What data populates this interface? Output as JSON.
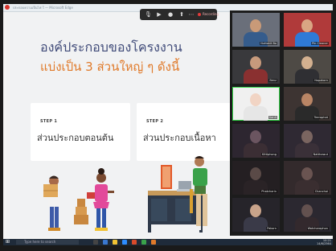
{
  "app": {
    "window_title": "ประกอบความเป็นไฟ ใ — Microsoft Edge",
    "record_label": "Recording"
  },
  "slide": {
    "heading_line1": "องค์ประกอบของโครงงาน",
    "heading_line2": "แบ่งเป็น 3 ส่วนใหญ่ ๆ ดังนี้",
    "cards": [
      {
        "step": "STEP 1",
        "label": "ส่วนประกอบตอนต้น"
      },
      {
        "step": "STEP 2",
        "label": "ส่วนประกอบเนื้อหา"
      }
    ]
  },
  "participants": [
    {
      "name": "Nuttakit Bo",
      "bg": "#6a6f7a",
      "face": "#c99a78",
      "shirt": "#355c8c"
    },
    {
      "name": "Pin Cleaner",
      "bg": "#b03a3a",
      "face": "#d9a583",
      "shirt": "#2f7ad6"
    },
    {
      "name": "Benz",
      "bg": "#39393c",
      "face": "#c79a7c",
      "shirt": "#8a3030"
    },
    {
      "name": "Nopakorn",
      "bg": "#4e4a45",
      "face": "#d3b08f",
      "shirt": "#2f2f33"
    },
    {
      "name": "Kanit",
      "bg": "#f0f0f0",
      "face": "#f1d4c4",
      "shirt": "#e6e6e6"
    },
    {
      "name": "Teeraphat",
      "bg": "#3d3432",
      "face": "#b98565",
      "shirt": "#2a2a2a"
    },
    {
      "name": "Kittiphong",
      "bg": "#2d2630",
      "face": "#6b5560",
      "shirt": "#3b2e34"
    },
    {
      "name": "Natthawut",
      "bg": "#2f2933",
      "face": "#7a6560",
      "shirt": "#3a3038"
    },
    {
      "name": "Phatcharin",
      "bg": "#241f22",
      "face": "#5a4a47",
      "shirt": "#2a2326"
    },
    {
      "name": "Chanchai",
      "bg": "#332a2c",
      "face": "#6a5451",
      "shirt": "#3a2e30"
    },
    {
      "name": "Pakorn",
      "bg": "#26242a",
      "face": "#c8a38a",
      "shirt": "#3a3a48"
    },
    {
      "name": "Watcharaphon",
      "bg": "#2b2830",
      "face": "#63514f",
      "shirt": "#33292d"
    }
  ],
  "taskbar": {
    "search_placeholder": "Type here to search",
    "time": "10:21",
    "date": "14/6/2564"
  },
  "colors": {
    "heading_blue": "#3f4a78",
    "heading_orange": "#e07a2a",
    "active_speaker": "#37d64a"
  }
}
